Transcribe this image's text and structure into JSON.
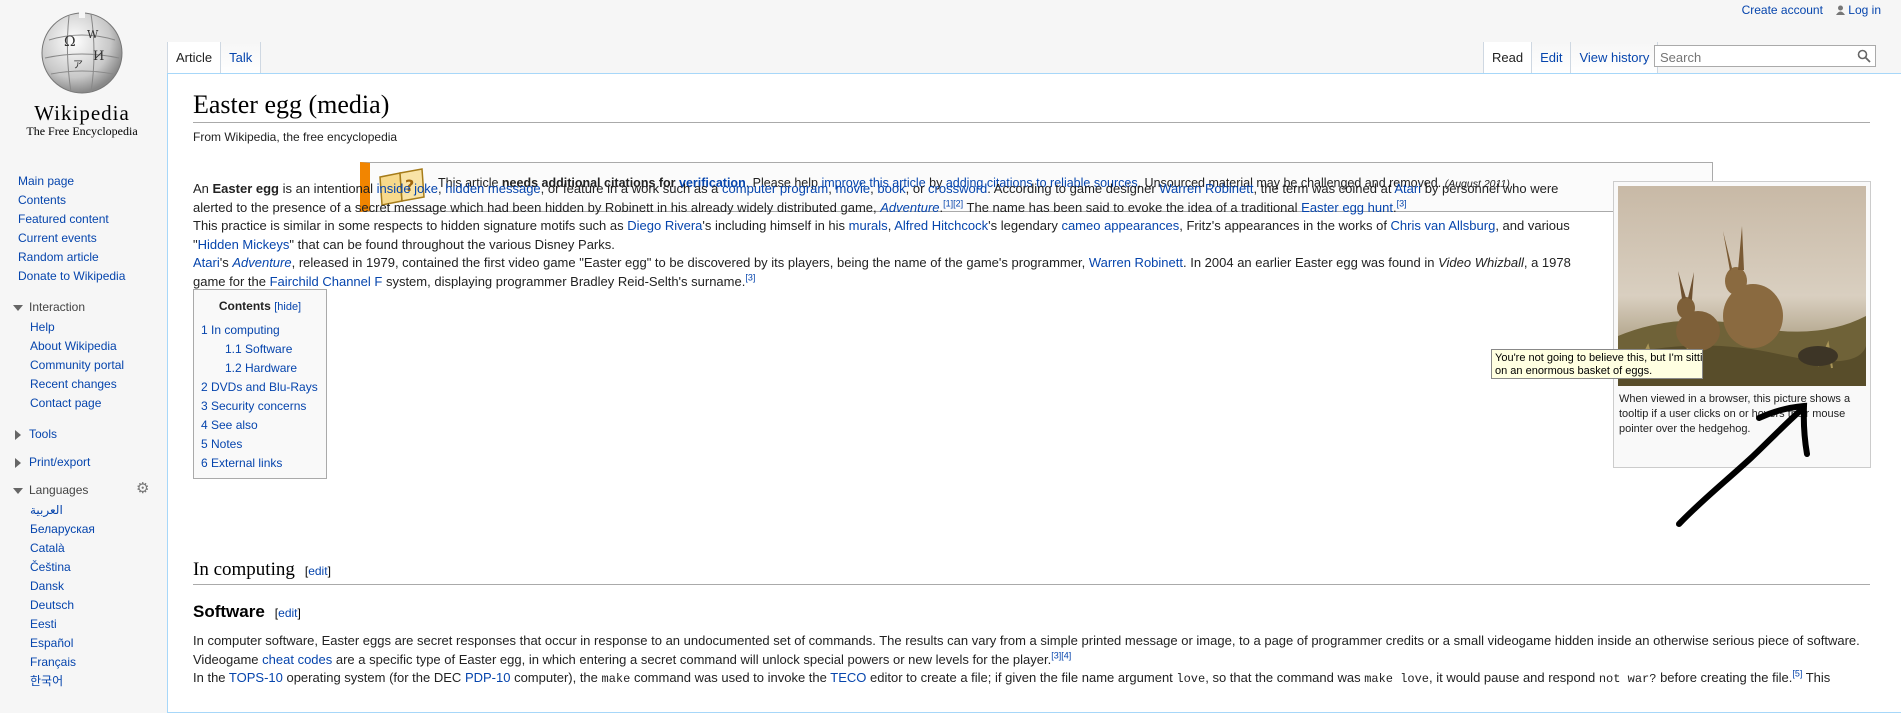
{
  "logo": {
    "wordmark": "Wikipedia",
    "tagline": "The Free Encyclopedia"
  },
  "personal": {
    "create_account": "Create account",
    "login": "Log in"
  },
  "tabs": {
    "left": [
      "Article",
      "Talk"
    ],
    "right": [
      "Read",
      "Edit",
      "View history"
    ]
  },
  "search": {
    "placeholder": "Search"
  },
  "sidebar": {
    "nav": [
      "Main page",
      "Contents",
      "Featured content",
      "Current events",
      "Random article",
      "Donate to Wikipedia"
    ],
    "interaction_heading": "Interaction",
    "interaction": [
      "Help",
      "About Wikipedia",
      "Community portal",
      "Recent changes",
      "Contact page"
    ],
    "tools": "Tools",
    "print_export": "Print/export",
    "languages_heading": "Languages",
    "languages": [
      "العربية",
      "Беларуская",
      "Català",
      "Čeština",
      "Dansk",
      "Deutsch",
      "Eesti",
      "Español",
      "Français",
      "한국어"
    ]
  },
  "article": {
    "title": "Easter egg (media)",
    "site_sub": "From Wikipedia, the free encyclopedia",
    "ambox": {
      "t1": "This article ",
      "t2": "needs additional citations for ",
      "link1": "verification",
      "t3": ". Please help ",
      "link2": "improve this article",
      "t4": " by ",
      "link3": "adding citations to reliable sources",
      "t5": ". Unsourced material may be challenged and removed. ",
      "date": "(August 2011)"
    },
    "p1": {
      "a": "An ",
      "b": "Easter egg",
      "c": " is an intentional ",
      "l1": "inside joke",
      "d": ", ",
      "l2": "hidden message",
      "e": ", or feature in a work such as a ",
      "l3": "computer program",
      "f": ", ",
      "l4": "movie",
      "g": ", ",
      "l5": "book",
      "h": ", or ",
      "l6": "crossword",
      "i": ". According to game designer ",
      "l7": "Warren Robinett",
      "j": ", the term was coined at ",
      "l8": "Atari",
      "k": " by personnel who were alerted to the presence of a secret message which had been hidden by Robinett in his already widely distributed game, ",
      "l9": "Adventure",
      "m": ".",
      "s1": "[1][2]",
      "n": " The name has been said to evoke the idea of a traditional ",
      "l10": "Easter egg hunt",
      "o": ".",
      "s2": "[3]"
    },
    "p2": {
      "a": "This practice is similar in some respects to hidden signature motifs such as ",
      "l1": "Diego Rivera",
      "b": "'s including himself in his ",
      "l2": "murals",
      "c": ", ",
      "l3": "Alfred Hitchcock",
      "d": "'s legendary ",
      "l4": "cameo appearances",
      "e": ", Fritz's appearances in the works of ",
      "l5": "Chris van Allsburg",
      "f": ", and various \"",
      "l6": "Hidden Mickeys",
      "g": "\" that can be found throughout the various Disney Parks."
    },
    "p3": {
      "l1": "Atari",
      "a": "'s ",
      "l2": "Adventure",
      "b": ", released in 1979, contained the first video game \"Easter egg\" to be discovered by its players, being the name of the game's programmer, ",
      "l3": "Warren Robinett",
      "c": ". In 2004 an earlier Easter egg was found in ",
      "d": "Video Whizball",
      "e": ", a 1978 game for the ",
      "l4": "Fairchild Channel F",
      "f": " system, displaying programmer Bradley Reid-Selth's surname.",
      "s1": "[3]"
    },
    "thumb": {
      "caption": "When viewed in a browser, this picture shows a tooltip if a user clicks on or hovers their mouse pointer over the hedgehog.",
      "tooltip_line1": "You're not going to believe this, but I'm sitting",
      "tooltip_line2": "on an enormous basket of eggs."
    },
    "toc": {
      "title": "Contents",
      "hide": "[hide]",
      "items": [
        {
          "label": "1 In computing"
        },
        {
          "label": "1.1 Software"
        },
        {
          "label": "1.2 Hardware"
        },
        {
          "label": "2 DVDs and Blu-Rays"
        },
        {
          "label": "3 Security concerns"
        },
        {
          "label": "4 See also"
        },
        {
          "label": "5 Notes"
        },
        {
          "label": "6 External links"
        }
      ]
    },
    "h2_computing": "In computing",
    "h3_software": "Software",
    "edit": "edit",
    "p4": {
      "a": "In computer software, Easter eggs are secret responses that occur in response to an undocumented set of commands. The results can vary from a simple printed message or image, to a page of programmer credits or a small videogame hidden inside an otherwise serious piece of software. Videogame ",
      "l1": "cheat codes",
      "b": " are a specific type of Easter egg, in which entering a secret command will unlock special powers or new levels for the player.",
      "s1": "[3][4]"
    },
    "p5": {
      "a": "In the ",
      "l1": "TOPS-10",
      "b": " operating system (for the DEC ",
      "l2": "PDP-10",
      "c": " computer), the ",
      "m1": "make",
      "d": " command was used to invoke the ",
      "l3": "TECO",
      "e": " editor to create a file; if given the file name argument ",
      "m2": "love",
      "f": ", so that the command was ",
      "m3": "make love",
      "g": ", it would pause and respond ",
      "m4": "not war?",
      "h": " before creating the file.",
      "s1": "[5]",
      "i": " This"
    }
  }
}
